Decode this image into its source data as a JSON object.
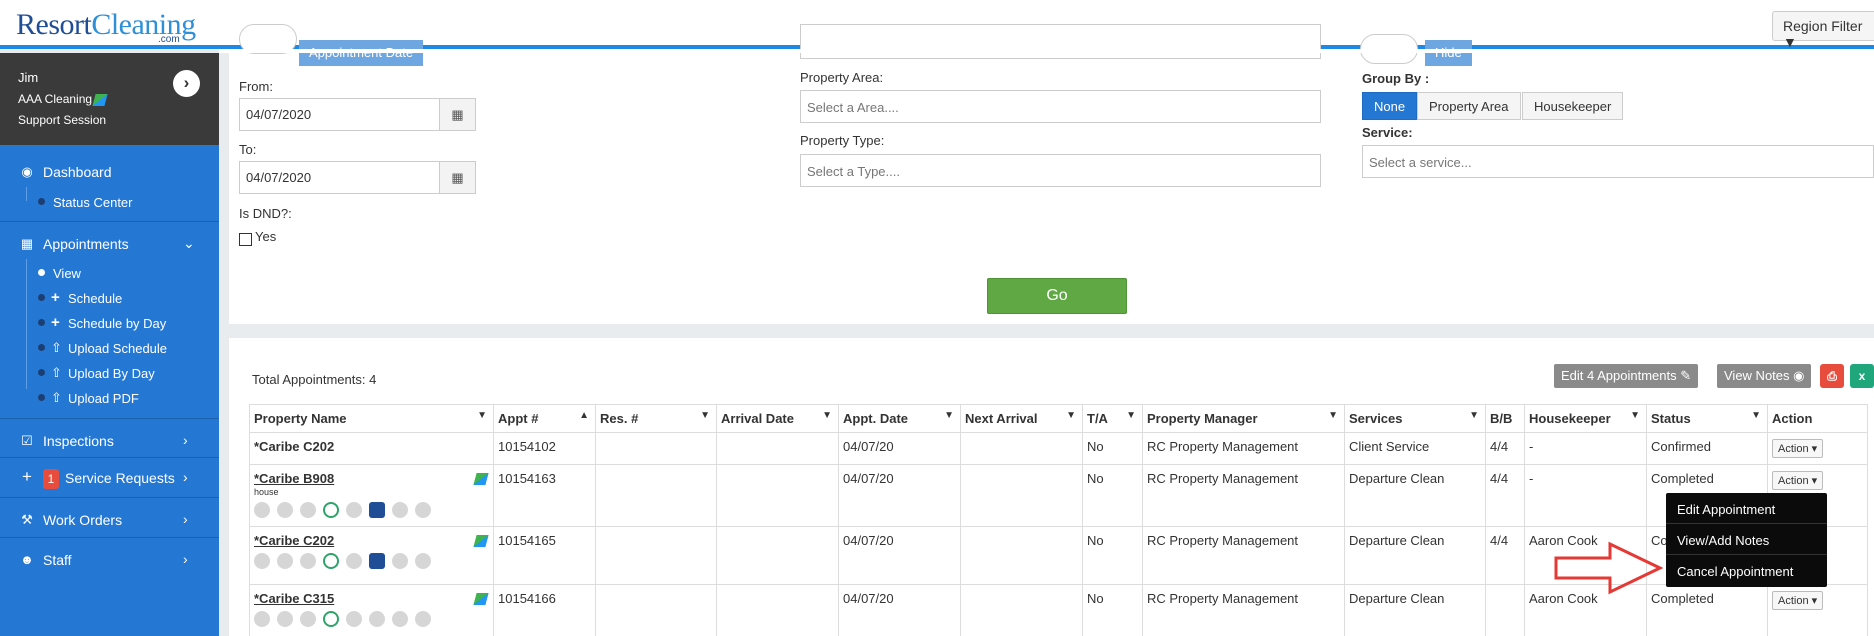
{
  "header": {
    "logo_part1": "Resort",
    "logo_part2": "Cleaning",
    "logo_sub": ".com",
    "region_filter": "Region Filter"
  },
  "user": {
    "name": "Jim",
    "company": "AAA Cleaning",
    "session": "Support Session"
  },
  "nav": {
    "dashboard": "Dashboard",
    "status_center": "Status Center",
    "appointments": "Appointments",
    "view": "View",
    "schedule": "Schedule",
    "schedule_by_day": "Schedule by Day",
    "upload_schedule": "Upload Schedule",
    "upload_by_day": "Upload By Day",
    "upload_pdf": "Upload PDF",
    "inspections": "Inspections",
    "service_requests": "Service Requests",
    "service_requests_badge": "1",
    "work_orders": "Work Orders",
    "staff": "Staff"
  },
  "filters": {
    "appointment_date_btn": "Appointment Date",
    "hide_btn": "Hide",
    "from_label": "From:",
    "from_value": "04/07/2020",
    "to_label": "To:",
    "to_value": "04/07/2020",
    "is_dnd_label": "Is DND?:",
    "yes_label": "Yes",
    "property_area_label": "Property Area:",
    "property_area_placeholder": "Select a Area....",
    "property_type_label": "Property Type:",
    "property_type_placeholder": "Select a Type....",
    "group_by_label": "Group By :",
    "group_by_options": [
      "None",
      "Property Area",
      "Housekeeper"
    ],
    "service_label": "Service:",
    "service_placeholder": "Select a service...",
    "go": "Go"
  },
  "table": {
    "total_label": "Total Appointments: 4",
    "edit_btn": "Edit 4 Appointments",
    "view_notes_btn": "View Notes",
    "columns": [
      "Property Name",
      "Appt #",
      "Res. #",
      "Arrival Date",
      "Appt. Date",
      "Next Arrival",
      "T/A",
      "Property Manager",
      "Services",
      "B/B",
      "Housekeeper",
      "Status",
      "Action"
    ],
    "rows": [
      {
        "property": "*Caribe C202",
        "type": "",
        "appt": "10154102",
        "res": "",
        "arrival": "",
        "appt_date": "04/07/20",
        "next": "",
        "ta": "No",
        "manager": "RC Property Management",
        "service": "Client Service",
        "bb": "4/4",
        "hk": "-",
        "status": "Confirmed",
        "action": "Action"
      },
      {
        "property": "*Caribe B908",
        "type": "house",
        "appt": "10154163",
        "res": "",
        "arrival": "",
        "appt_date": "04/07/20",
        "next": "",
        "ta": "No",
        "manager": "RC Property Management",
        "service": "Departure Clean",
        "bb": "4/4",
        "hk": "-",
        "status": "Completed",
        "action": "Action"
      },
      {
        "property": "*Caribe C202",
        "type": "",
        "appt": "10154165",
        "res": "",
        "arrival": "",
        "appt_date": "04/07/20",
        "next": "",
        "ta": "No",
        "manager": "RC Property Management",
        "service": "Departure Clean",
        "bb": "4/4",
        "hk": "Aaron Cook",
        "status": "Co",
        "action": ""
      },
      {
        "property": "*Caribe C315",
        "type": "",
        "appt": "10154166",
        "res": "",
        "arrival": "",
        "appt_date": "04/07/20",
        "next": "",
        "ta": "No",
        "manager": "RC Property Management",
        "service": "Departure Clean",
        "bb": "",
        "hk": "Aaron Cook",
        "status": "Completed",
        "action": "Action"
      }
    ]
  },
  "action_menu": [
    "Edit Appointment",
    "View/Add Notes",
    "Cancel Appointment"
  ],
  "colors": {
    "sidebar": "#2478d4",
    "go": "#5fa843",
    "annotation_arrow": "#e53935"
  }
}
